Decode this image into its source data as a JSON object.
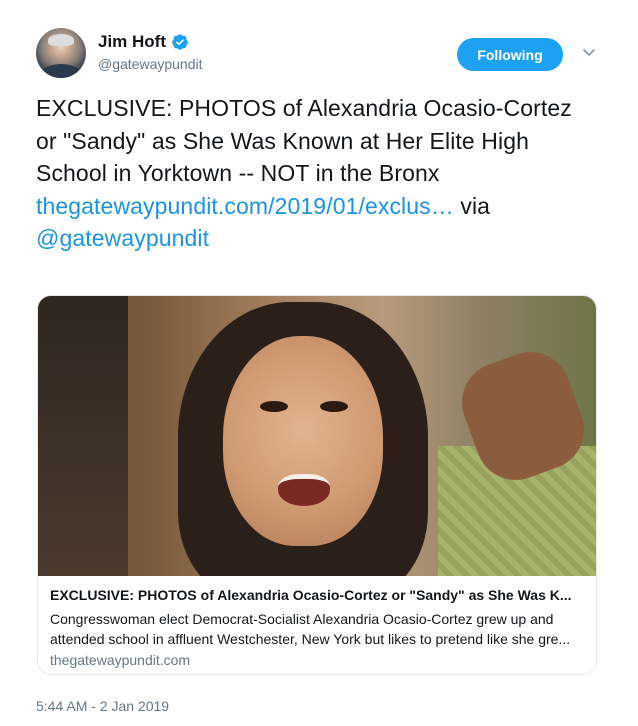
{
  "author": {
    "name": "Jim Hoft",
    "handle": "@gatewaypundit",
    "verified": true
  },
  "follow_button": {
    "label": "Following"
  },
  "tweet": {
    "text_main": "EXCLUSIVE: PHOTOS of Alexandria Ocasio-Cortez or \"Sandy\" as She Was Known at Her Elite High School in Yorktown -- NOT in the Bronx",
    "link": "thegatewaypundit.com/2019/01/exclus…",
    "via_word": "via",
    "mention": "@gatewaypundit"
  },
  "card": {
    "title": "EXCLUSIVE: PHOTOS of Alexandria Ocasio-Cortez or \"Sandy\" as She Was K...",
    "description": "Congresswoman elect Democrat-Socialist Alexandria Ocasio-Cortez grew up and attended school in affluent Westchester, New York but likes to pretend like she gre...",
    "domain": "thegatewaypundit.com"
  },
  "timestamp": "5:44 AM - 2 Jan 2019",
  "colors": {
    "accent": "#1da1f2",
    "link": "#1b95e0",
    "muted": "#657786"
  },
  "icons": {
    "verified": "verified-badge-icon",
    "menu": "chevron-down-icon"
  }
}
